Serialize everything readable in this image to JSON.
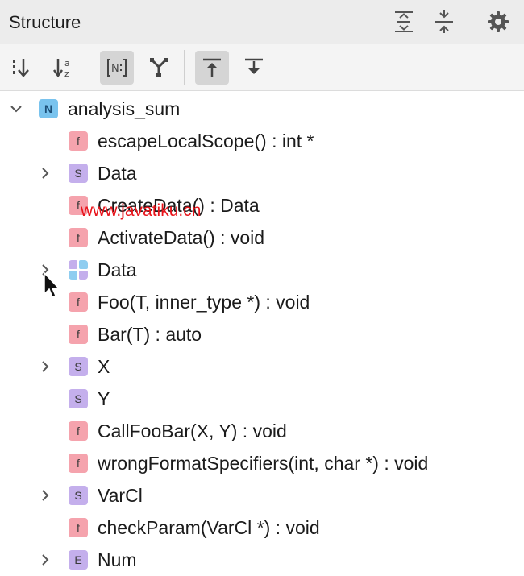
{
  "header": {
    "title": "Structure",
    "actions": [
      "expand-all-icon",
      "collapse-all-icon",
      "gear-icon"
    ]
  },
  "toolbar": {
    "buttons": [
      {
        "icon": "sort-by-visibility-icon",
        "active": false
      },
      {
        "icon": "sort-alphabetically-icon",
        "active": false
      },
      {
        "icon": "show-namespaces-icon",
        "active": true
      },
      {
        "icon": "group-merge-icon",
        "active": false
      },
      {
        "icon": "autoscroll-to-source-icon",
        "active": true
      },
      {
        "icon": "autoscroll-from-source-icon",
        "active": false
      }
    ]
  },
  "tree": {
    "root": {
      "badge": "N",
      "kind": "namespace",
      "label": "analysis_sum",
      "expanded": true
    },
    "items": [
      {
        "badge": "f",
        "kind": "function",
        "label": "escapeLocalScope() : int *",
        "expandable": false
      },
      {
        "badge": "S",
        "kind": "struct",
        "label": "Data",
        "expandable": true
      },
      {
        "badge": "f",
        "kind": "function",
        "label": "CreateData() : Data",
        "expandable": false
      },
      {
        "badge": "f",
        "kind": "function",
        "label": "ActivateData() : void",
        "expandable": false
      },
      {
        "badge": "",
        "kind": "union",
        "label": "Data",
        "expandable": true
      },
      {
        "badge": "f",
        "kind": "function",
        "label": "Foo(T, inner_type *) : void",
        "expandable": false
      },
      {
        "badge": "f",
        "kind": "function",
        "label": "Bar(T) : auto",
        "expandable": false
      },
      {
        "badge": "S",
        "kind": "struct",
        "label": "X",
        "expandable": true
      },
      {
        "badge": "S",
        "kind": "struct",
        "label": "Y",
        "expandable": false
      },
      {
        "badge": "f",
        "kind": "function",
        "label": "CallFooBar(X, Y) : void",
        "expandable": false
      },
      {
        "badge": "f",
        "kind": "function",
        "label": "wrongFormatSpecifiers(int, char *) : void",
        "expandable": false
      },
      {
        "badge": "S",
        "kind": "struct",
        "label": "VarCl",
        "expandable": true
      },
      {
        "badge": "f",
        "kind": "function",
        "label": "checkParam(VarCl *) : void",
        "expandable": false
      },
      {
        "badge": "E",
        "kind": "enum",
        "label": "Num",
        "expandable": true
      }
    ]
  },
  "watermark": "www.javatiku.cn",
  "colors": {
    "function_badge": "#f5a3ad",
    "struct_badge": "#c4afec",
    "namespace_badge": "#79c3ee",
    "active_button": "#d5d5d5"
  }
}
